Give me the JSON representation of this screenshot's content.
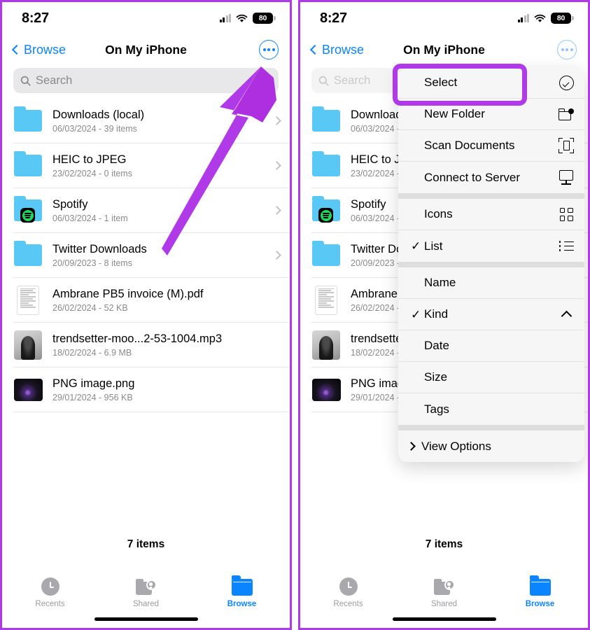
{
  "accent": {
    "annotation_purple": "#b13ae8",
    "ios_blue": "#0a84ff",
    "folder_blue": "#5ac8f5"
  },
  "status_bar": {
    "time": "8:27",
    "battery": "80",
    "cellular_icon": "cellular-bars-icon",
    "wifi_icon": "wifi-icon",
    "battery_icon": "battery-icon"
  },
  "nav": {
    "back_label": "Browse",
    "title": "On My iPhone",
    "more_icon": "ellipsis-circle-icon"
  },
  "search": {
    "placeholder": "Search",
    "search_icon": "search-icon",
    "mic_icon": "microphone-icon"
  },
  "files": [
    {
      "name": "Downloads (local)",
      "meta": "06/03/2024 - 39 items",
      "thumb": "folder-icon"
    },
    {
      "name": "HEIC to JPEG",
      "meta": "23/02/2024 - 0 items",
      "thumb": "folder-icon"
    },
    {
      "name": "Spotify",
      "meta": "06/03/2024 - 1 item",
      "thumb": "folder-spotify-icon"
    },
    {
      "name": "Twitter Downloads",
      "meta": "20/09/2023 - 8 items",
      "thumb": "folder-icon"
    },
    {
      "name": "Ambrane PB5 invoice (M).pdf",
      "meta": "26/02/2024 - 52 KB",
      "thumb": "pdf-document-thumbnail"
    },
    {
      "name": "trendsetter-moo...2-53-1004.mp3",
      "meta": "18/02/2024 - 6.9 MB",
      "thumb": "audio-artwork-thumbnail"
    },
    {
      "name": "PNG image.png",
      "meta": "29/01/2024 - 956 KB",
      "thumb": "png-image-thumbnail"
    }
  ],
  "footer": {
    "count": "7 items"
  },
  "tabs": [
    {
      "label": "Recents",
      "icon": "clock-icon",
      "active": false
    },
    {
      "label": "Shared",
      "icon": "shared-folder-icon",
      "active": false
    },
    {
      "label": "Browse",
      "icon": "folder-icon",
      "active": true
    }
  ],
  "context_menu": {
    "groups": [
      {
        "items": [
          {
            "label": "Select",
            "icon": "checkmark-circle-icon",
            "checked": false,
            "highlighted": true
          },
          {
            "label": "New Folder",
            "icon": "folder-badge-plus-icon",
            "checked": false
          },
          {
            "label": "Scan Documents",
            "icon": "doc-viewfinder-icon",
            "checked": false
          },
          {
            "label": "Connect to Server",
            "icon": "display-icon",
            "checked": false
          }
        ]
      },
      {
        "items": [
          {
            "label": "Icons",
            "icon": "square-grid-icon",
            "checked": false
          },
          {
            "label": "List",
            "icon": "list-bullet-icon",
            "checked": true
          }
        ]
      },
      {
        "items": [
          {
            "label": "Name",
            "icon": "",
            "checked": false
          },
          {
            "label": "Kind",
            "icon": "chevron-up-icon",
            "checked": true
          },
          {
            "label": "Date",
            "icon": "",
            "checked": false
          },
          {
            "label": "Size",
            "icon": "",
            "checked": false
          },
          {
            "label": "Tags",
            "icon": "",
            "checked": false
          }
        ]
      },
      {
        "items": [
          {
            "label": "View Options",
            "icon": "chevron-right-icon",
            "checked": false,
            "leading_chevron": true
          }
        ]
      }
    ]
  }
}
